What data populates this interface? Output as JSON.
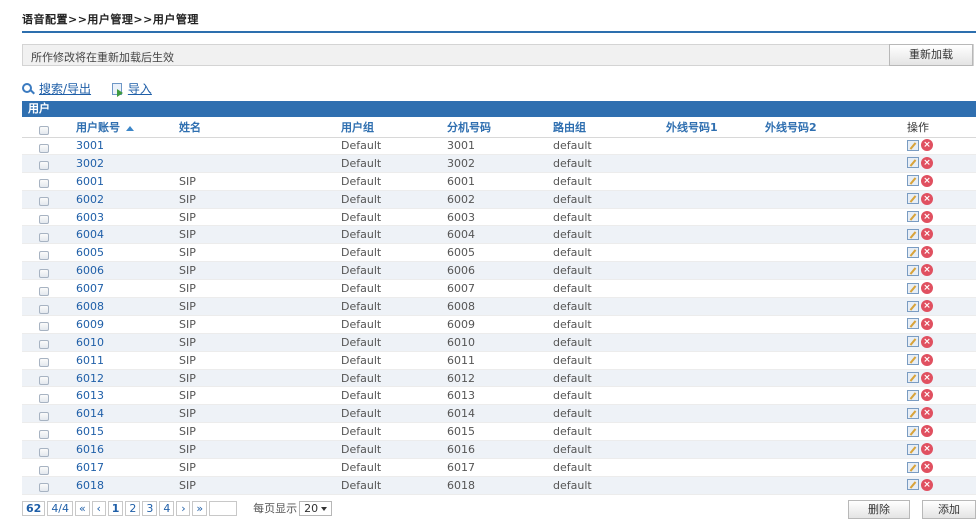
{
  "breadcrumb": "语音配置>>用户管理>>用户管理",
  "notice": {
    "text": "所作修改将在重新加载后生效",
    "reload_label": "重新加载"
  },
  "toolbar": {
    "search_export_label": "搜索/导出",
    "import_label": "导入"
  },
  "panel_title": "用户",
  "columns": {
    "account": "用户账号",
    "name": "姓名",
    "group": "用户组",
    "extension": "分机号码",
    "route_group": "路由组",
    "outside1": "外线号码1",
    "outside2": "外线号码2",
    "operation": "操作"
  },
  "rows": [
    {
      "account": "3001",
      "name": "",
      "group": "Default",
      "extension": "3001",
      "route": "default"
    },
    {
      "account": "3002",
      "name": "",
      "group": "Default",
      "extension": "3002",
      "route": "default"
    },
    {
      "account": "6001",
      "name": "SIP",
      "group": "Default",
      "extension": "6001",
      "route": "default"
    },
    {
      "account": "6002",
      "name": "SIP",
      "group": "Default",
      "extension": "6002",
      "route": "default"
    },
    {
      "account": "6003",
      "name": "SIP",
      "group": "Default",
      "extension": "6003",
      "route": "default"
    },
    {
      "account": "6004",
      "name": "SIP",
      "group": "Default",
      "extension": "6004",
      "route": "default"
    },
    {
      "account": "6005",
      "name": "SIP",
      "group": "Default",
      "extension": "6005",
      "route": "default"
    },
    {
      "account": "6006",
      "name": "SIP",
      "group": "Default",
      "extension": "6006",
      "route": "default"
    },
    {
      "account": "6007",
      "name": "SIP",
      "group": "Default",
      "extension": "6007",
      "route": "default"
    },
    {
      "account": "6008",
      "name": "SIP",
      "group": "Default",
      "extension": "6008",
      "route": "default"
    },
    {
      "account": "6009",
      "name": "SIP",
      "group": "Default",
      "extension": "6009",
      "route": "default"
    },
    {
      "account": "6010",
      "name": "SIP",
      "group": "Default",
      "extension": "6010",
      "route": "default"
    },
    {
      "account": "6011",
      "name": "SIP",
      "group": "Default",
      "extension": "6011",
      "route": "default"
    },
    {
      "account": "6012",
      "name": "SIP",
      "group": "Default",
      "extension": "6012",
      "route": "default"
    },
    {
      "account": "6013",
      "name": "SIP",
      "group": "Default",
      "extension": "6013",
      "route": "default"
    },
    {
      "account": "6014",
      "name": "SIP",
      "group": "Default",
      "extension": "6014",
      "route": "default"
    },
    {
      "account": "6015",
      "name": "SIP",
      "group": "Default",
      "extension": "6015",
      "route": "default"
    },
    {
      "account": "6016",
      "name": "SIP",
      "group": "Default",
      "extension": "6016",
      "route": "default"
    },
    {
      "account": "6017",
      "name": "SIP",
      "group": "Default",
      "extension": "6017",
      "route": "default"
    },
    {
      "account": "6018",
      "name": "SIP",
      "group": "Default",
      "extension": "6018",
      "route": "default"
    }
  ],
  "pager": {
    "total": "62",
    "page_status": "4/4",
    "first": "«",
    "prev": "‹",
    "pages": [
      "1",
      "2",
      "3",
      "4"
    ],
    "next": "›",
    "last": "»",
    "per_page_label": "每页显示",
    "per_page_value": "20"
  },
  "buttons": {
    "delete": "删除",
    "add": "添加"
  },
  "colors": {
    "accent": "#2f6fb0",
    "link": "#1f5fa8",
    "delete_icon": "#e05060"
  }
}
